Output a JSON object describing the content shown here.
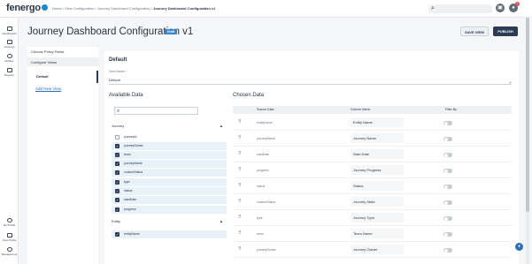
{
  "brand": {
    "logo": "fenergo"
  },
  "breadcrumb": {
    "prefix": "Home / View Configuration / Journey Dashboard Configuration / ",
    "current": "Journey Dashboard Configuration v1"
  },
  "leftnav": [
    {
      "label": "Dashboards",
      "icon": "dashboard-icon"
    },
    {
      "label": "Journeys",
      "icon": "folder-icon"
    },
    {
      "label": "Entities",
      "icon": "user-icon"
    },
    {
      "label": "Reports",
      "icon": "bar-chart-icon"
    },
    {
      "label": "My Profile",
      "icon": "profile-icon"
    },
    {
      "label": "View Profile",
      "icon": "view-profile-icon"
    },
    {
      "label": "Management",
      "icon": "settings-icon"
    }
  ],
  "header": {
    "title": "Journey Dashboard Configuration v1",
    "status_badge": "Draft",
    "save_label": "SAVE VIEW",
    "publish_label": "PUBLISH"
  },
  "policy_panel": {
    "choose_label": "Choose Policy Fields",
    "configure_label": "Configure Views",
    "default_label": "Default",
    "add_label": "Add New View"
  },
  "view": {
    "heading": "Default",
    "name_label": "View Name",
    "name_required": "*",
    "name_value": "Default"
  },
  "available": {
    "title": "Available Data",
    "search_placeholder": "",
    "groups": [
      {
        "name": "Journey",
        "fields": [
          {
            "name": "journeyId",
            "checked": false
          },
          {
            "name": "journeyOwner",
            "checked": true
          },
          {
            "name": "team",
            "checked": true
          },
          {
            "name": "journeyName",
            "checked": true
          },
          {
            "name": "customStatus",
            "checked": true
          },
          {
            "name": "type",
            "checked": true
          },
          {
            "name": "status",
            "checked": true
          },
          {
            "name": "startDate",
            "checked": true
          },
          {
            "name": "progress",
            "checked": true
          }
        ]
      },
      {
        "name": "Entity",
        "fields": [
          {
            "name": "entityName",
            "checked": true
          }
        ]
      }
    ]
  },
  "chosen": {
    "title": "Chosen Data",
    "columns": [
      "Source Data",
      "Column Name",
      "Filter By"
    ],
    "rows": [
      {
        "source": "entityName",
        "column": "Entity Name"
      },
      {
        "source": "journeyName",
        "column": "Journey Name"
      },
      {
        "source": "startDate",
        "column": "Start Date"
      },
      {
        "source": "progress",
        "column": "Journey Progress"
      },
      {
        "source": "status",
        "column": "Status"
      },
      {
        "source": "customStatus",
        "column": "Journey State"
      },
      {
        "source": "type",
        "column": "Journey Type"
      },
      {
        "source": "team",
        "column": "Team Name"
      },
      {
        "source": "journeyOwner",
        "column": "Journey Owner"
      }
    ]
  }
}
